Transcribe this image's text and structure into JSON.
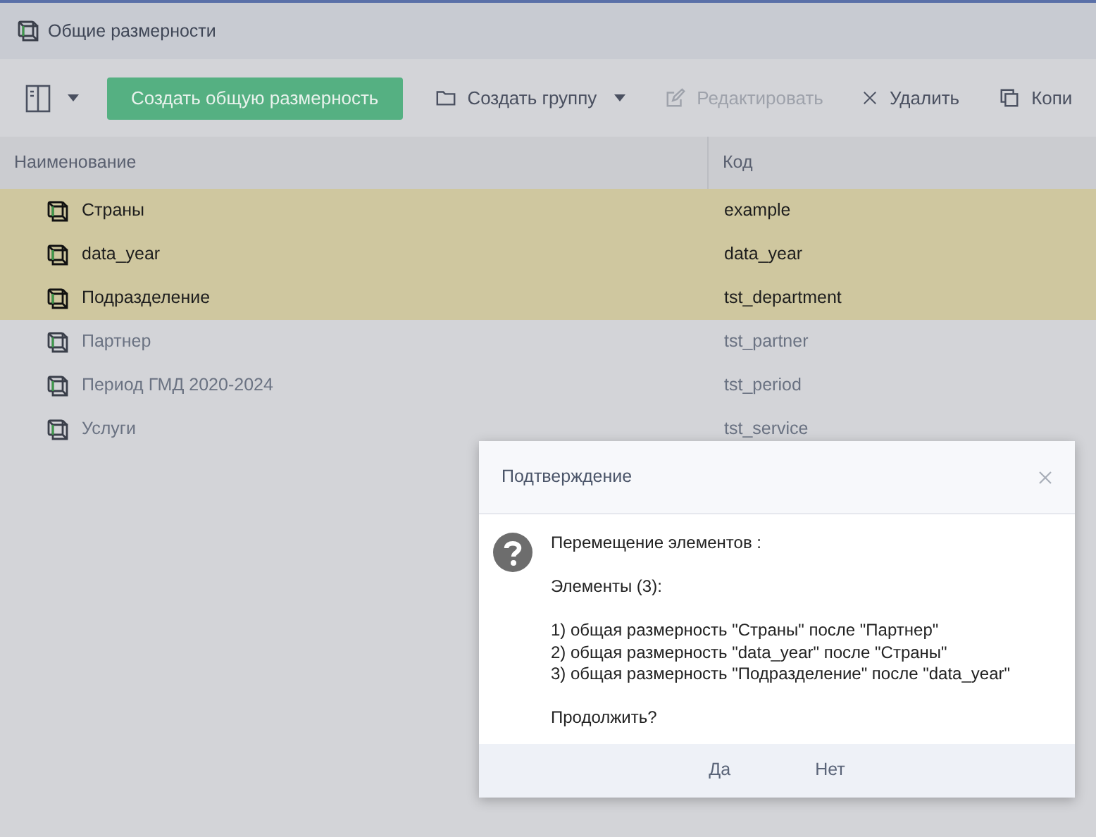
{
  "window": {
    "title": "Общие размерности"
  },
  "toolbar": [
    {
      "kind": "view",
      "disabled": false
    },
    {
      "kind": "primary",
      "label": "Создать общую размерность",
      "disabled": false
    },
    {
      "kind": "group",
      "label": "Создать группу",
      "disabled": false
    },
    {
      "kind": "edit",
      "label": "Редактировать",
      "disabled": true
    },
    {
      "kind": "delete",
      "label": "Удалить",
      "disabled": false
    },
    {
      "kind": "copy",
      "label": "Копи",
      "disabled": false
    }
  ],
  "table": {
    "columns": [
      "Наименование",
      "Код"
    ],
    "rows": [
      {
        "name": "Страны",
        "code": "example",
        "selected": true
      },
      {
        "name": "data_year",
        "code": "data_year",
        "selected": true
      },
      {
        "name": "Подразделение",
        "code": "tst_department",
        "selected": true
      },
      {
        "name": "Партнер",
        "code": "tst_partner",
        "selected": false
      },
      {
        "name": "Период ГМД 2020-2024",
        "code": "tst_period",
        "selected": false
      },
      {
        "name": "Услуги",
        "code": "tst_service",
        "selected": false
      }
    ]
  },
  "dialog": {
    "title": "Подтверждение",
    "paragraphs": [
      {
        "lines": [
          "Перемещение элементов :"
        ]
      },
      {
        "lines": [
          "Элементы (3):"
        ]
      },
      {
        "lines": [
          "1) общая размерность \"Страны\" после \"Партнер\"",
          "2) общая размерность \"data_year\" после \"Страны\"",
          "3) общая размерность \"Подразделение\" после \"data_year\""
        ]
      },
      {
        "lines": [
          "Продолжить?"
        ]
      }
    ],
    "buttons": [
      "Да",
      "Нет"
    ]
  }
}
